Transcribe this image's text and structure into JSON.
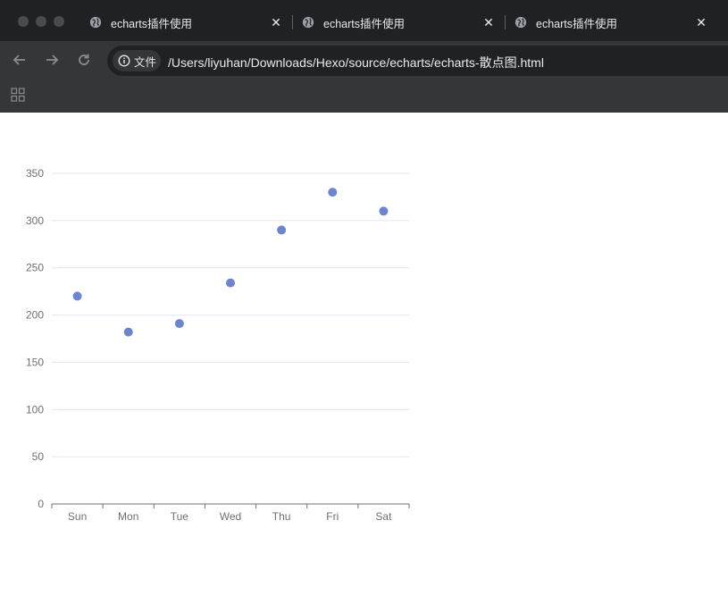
{
  "tabs": [
    {
      "title": "echarts插件使用",
      "close": "✕"
    },
    {
      "title": "echarts插件使用",
      "close": "✕"
    },
    {
      "title": "echarts插件使用",
      "close": "✕"
    }
  ],
  "omnibox": {
    "chip_label": "文件",
    "url": "/Users/liyuhan/Downloads/Hexo/source/echarts/echarts-散点图.html"
  },
  "icons": {
    "back": "arrow-left-icon",
    "forward": "arrow-right-icon",
    "reload": "reload-icon",
    "info": "info-icon",
    "apps": "apps-grid-icon",
    "tab": "globe-icon"
  },
  "colors": {
    "chrome_dark": "#202124",
    "chrome_toolbar": "#35363a",
    "point": "#5470c6"
  },
  "chart_data": {
    "type": "scatter",
    "categories": [
      "Sun",
      "Mon",
      "Tue",
      "Wed",
      "Thu",
      "Fri",
      "Sat"
    ],
    "values": [
      220,
      182,
      191,
      234,
      290,
      330,
      310
    ],
    "ylim": [
      0,
      350
    ],
    "yticks": [
      0,
      50,
      100,
      150,
      200,
      250,
      300,
      350
    ],
    "grid": true,
    "title": "",
    "xlabel": "",
    "ylabel": ""
  }
}
